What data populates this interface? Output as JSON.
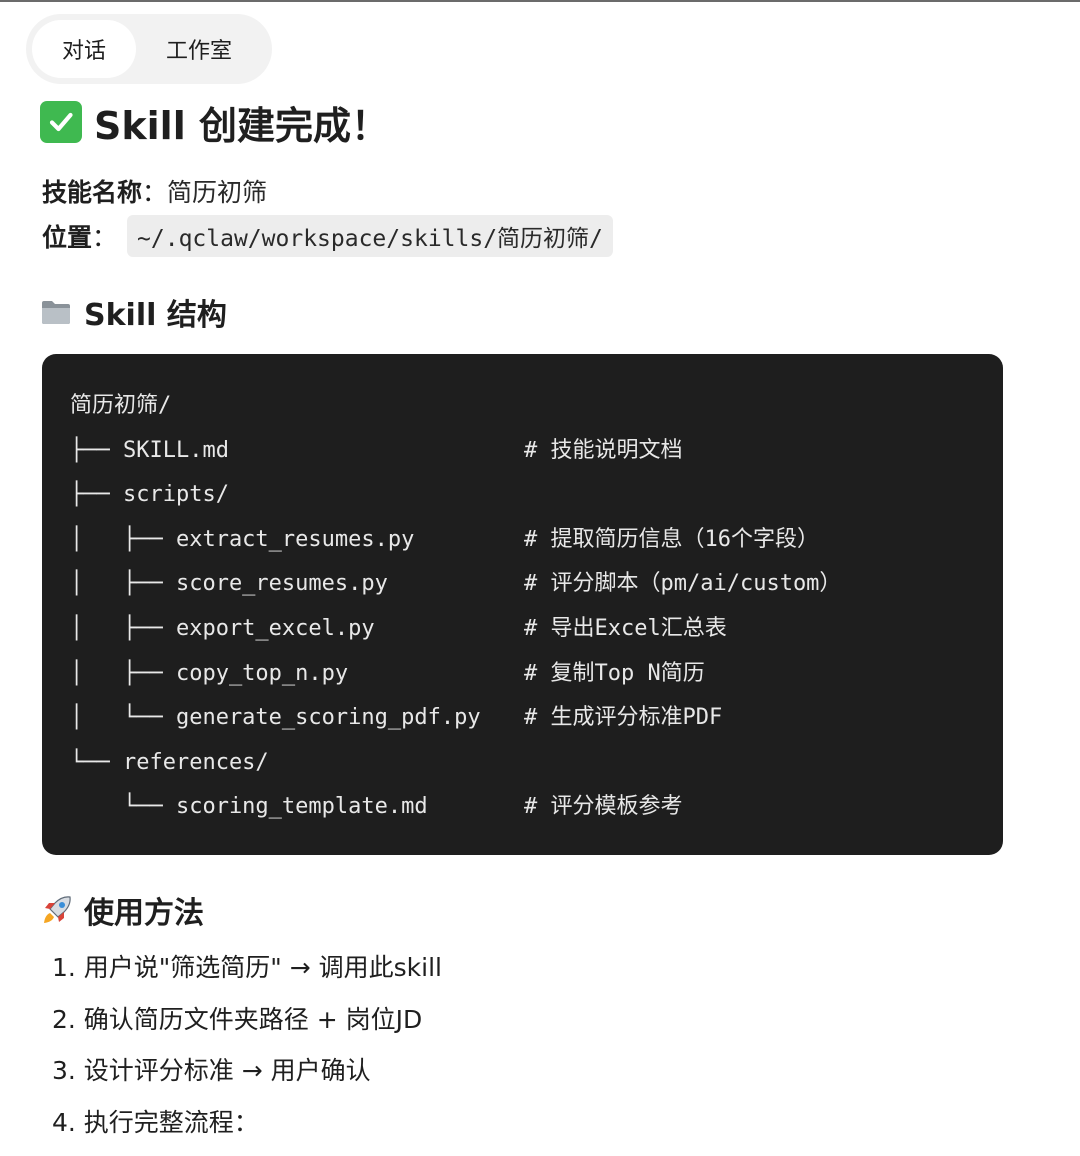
{
  "tabs": [
    {
      "label": "对话",
      "active": true
    },
    {
      "label": "工作室",
      "active": false
    }
  ],
  "heading": {
    "icon": "check-mark-icon",
    "text": "Skill 创建完成！"
  },
  "skill_name": {
    "label": "技能名称",
    "separator": "：",
    "value": "简历初筛"
  },
  "location": {
    "label": "位置",
    "separator": "：",
    "path": "~/.qclaw/workspace/skills/简历初筛/"
  },
  "structure_section": {
    "icon": "folder-icon",
    "title": "Skill 结构",
    "lines": [
      {
        "tree": "简历初筛/",
        "comment": ""
      },
      {
        "tree": "├── SKILL.md",
        "comment": "# 技能说明文档"
      },
      {
        "tree": "├── scripts/",
        "comment": ""
      },
      {
        "tree": "│   ├── extract_resumes.py",
        "comment": "# 提取简历信息（16个字段）"
      },
      {
        "tree": "│   ├── score_resumes.py",
        "comment": "# 评分脚本（pm/ai/custom）"
      },
      {
        "tree": "│   ├── export_excel.py",
        "comment": "# 导出Excel汇总表"
      },
      {
        "tree": "│   ├── copy_top_n.py",
        "comment": "# 复制Top N简历"
      },
      {
        "tree": "│   └── generate_scoring_pdf.py",
        "comment": "# 生成评分标准PDF"
      },
      {
        "tree": "└── references/",
        "comment": ""
      },
      {
        "tree": "    └── scoring_template.md",
        "comment": "# 评分模板参考"
      }
    ]
  },
  "usage_section": {
    "icon": "rocket-icon",
    "title": "使用方法",
    "steps": [
      "1. 用户说\"筛选简历\" → 调用此skill",
      "2. 确认简历文件夹路径 + 岗位JD",
      "3. 设计评分标准 → 用户确认",
      "4. 执行完整流程："
    ]
  },
  "colors": {
    "check_green": "#3fb950",
    "code_bg": "#1e1e1e",
    "tabs_bg": "#f2f2f2"
  }
}
